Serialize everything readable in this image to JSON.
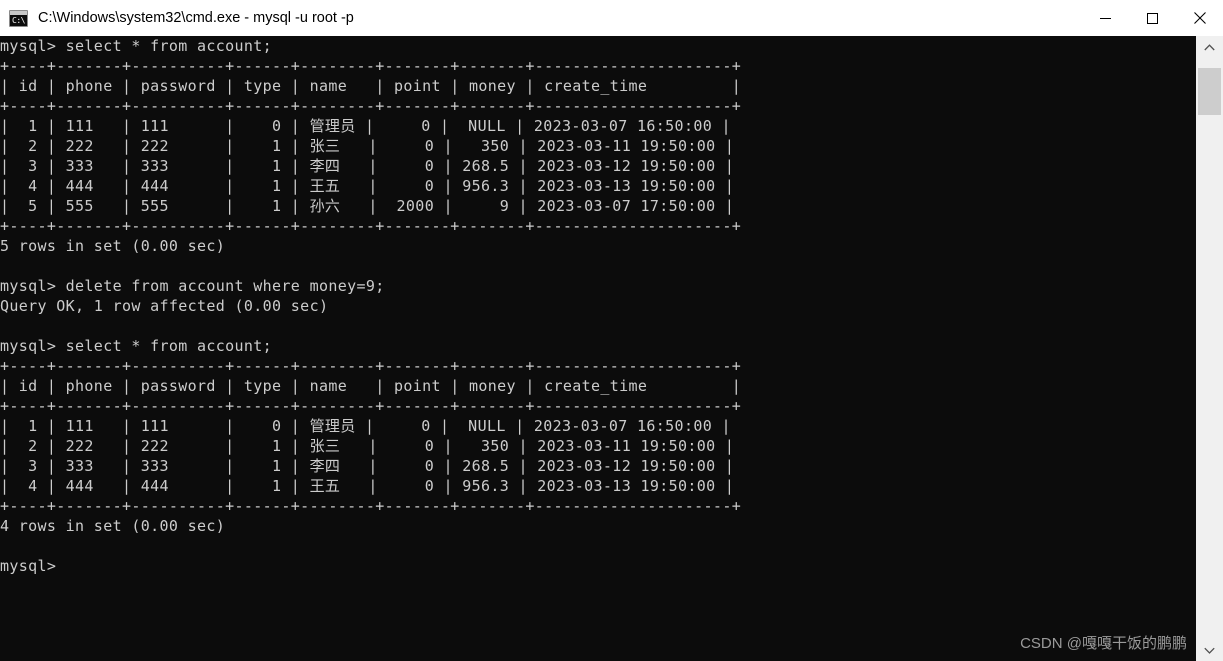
{
  "window": {
    "title": "C:\\Windows\\system32\\cmd.exe - mysql  -u root -p",
    "icon": "cmd-icon",
    "icon_glyph": "C:\\",
    "buttons": {
      "minimize": "minimize-button",
      "maximize": "maximize-button",
      "close": "close-button"
    },
    "titlebar_bg": "#ffffff",
    "title_color": "#000000"
  },
  "console": {
    "background": "#0c0c0c",
    "foreground": "#cccccc",
    "prompt": "mysql>",
    "commands": [
      "select * from account;",
      "delete from account where money=9;",
      "select * from account;"
    ],
    "messages": [
      "5 rows in set (0.00 sec)",
      "Query OK, 1 row affected (0.00 sec)",
      "4 rows in set (0.00 sec)"
    ],
    "result_tables": [
      {
        "separator": "+----+-------+----------+------+--------+-------+-------+---------------------+",
        "columns": [
          "id",
          "phone",
          "password",
          "type",
          "name",
          "point",
          "money",
          "create_time"
        ],
        "rows": [
          [
            "1",
            "111",
            "111",
            "0",
            "管理员",
            "0",
            "NULL",
            "2023-03-07 16:50:00"
          ],
          [
            "2",
            "222",
            "222",
            "1",
            "张三",
            "0",
            "350",
            "2023-03-11 19:50:00"
          ],
          [
            "3",
            "333",
            "333",
            "1",
            "李四",
            "0",
            "268.5",
            "2023-03-12 19:50:00"
          ],
          [
            "4",
            "444",
            "444",
            "1",
            "王五",
            "0",
            "956.3",
            "2023-03-13 19:50:00"
          ],
          [
            "5",
            "555",
            "555",
            "1",
            "孙六",
            "2000",
            "9",
            "2023-03-07 17:50:00"
          ]
        ],
        "row_count_label": "5 rows in set (0.00 sec)"
      },
      {
        "separator": "+----+-------+----------+------+--------+-------+-------+---------------------+",
        "columns": [
          "id",
          "phone",
          "password",
          "type",
          "name",
          "point",
          "money",
          "create_time"
        ],
        "rows": [
          [
            "1",
            "111",
            "111",
            "0",
            "管理员",
            "0",
            "NULL",
            "2023-03-07 16:50:00"
          ],
          [
            "2",
            "222",
            "222",
            "1",
            "张三",
            "0",
            "350",
            "2023-03-11 19:50:00"
          ],
          [
            "3",
            "333",
            "333",
            "1",
            "李四",
            "0",
            "268.5",
            "2023-03-12 19:50:00"
          ],
          [
            "4",
            "444",
            "444",
            "1",
            "王五",
            "0",
            "956.3",
            "2023-03-13 19:50:00"
          ]
        ],
        "row_count_label": "4 rows in set (0.00 sec)"
      }
    ],
    "full_text": "mysql> select * from account;\n+----+-------+----------+------+--------+-------+-------+---------------------+\n| id | phone | password | type | name   | point | money | create_time         |\n+----+-------+----------+------+--------+-------+-------+---------------------+\n|  1 | 111   | 111      |    0 | 管理员 |     0 |  NULL | 2023-03-07 16:50:00 |\n|  2 | 222   | 222      |    1 | 张三   |     0 |   350 | 2023-03-11 19:50:00 |\n|  3 | 333   | 333      |    1 | 李四   |     0 | 268.5 | 2023-03-12 19:50:00 |\n|  4 | 444   | 444      |    1 | 王五   |     0 | 956.3 | 2023-03-13 19:50:00 |\n|  5 | 555   | 555      |    1 | 孙六   |  2000 |     9 | 2023-03-07 17:50:00 |\n+----+-------+----------+------+--------+-------+-------+---------------------+\n5 rows in set (0.00 sec)\n\nmysql> delete from account where money=9;\nQuery OK, 1 row affected (0.00 sec)\n\nmysql> select * from account;\n+----+-------+----------+------+--------+-------+-------+---------------------+\n| id | phone | password | type | name   | point | money | create_time         |\n+----+-------+----------+------+--------+-------+-------+---------------------+\n|  1 | 111   | 111      |    0 | 管理员 |     0 |  NULL | 2023-03-07 16:50:00 |\n|  2 | 222   | 222      |    1 | 张三   |     0 |   350 | 2023-03-11 19:50:00 |\n|  3 | 333   | 333      |    1 | 李四   |     0 | 268.5 | 2023-03-12 19:50:00 |\n|  4 | 444   | 444      |    1 | 王五   |     0 | 956.3 | 2023-03-13 19:50:00 |\n+----+-------+----------+------+--------+-------+-------+---------------------+\n4 rows in set (0.00 sec)\n\nmysql>"
  },
  "watermark": {
    "text": "CSDN @嘎嘎干饭的鹏鹏",
    "color": "#9a9a9a"
  },
  "scrollbar": {
    "up_arrow": "scroll-up-arrow",
    "down_arrow": "scroll-down-arrow",
    "thumb": "scroll-thumb",
    "track_color": "#f0f0f0",
    "thumb_color": "#cdcdcd"
  }
}
